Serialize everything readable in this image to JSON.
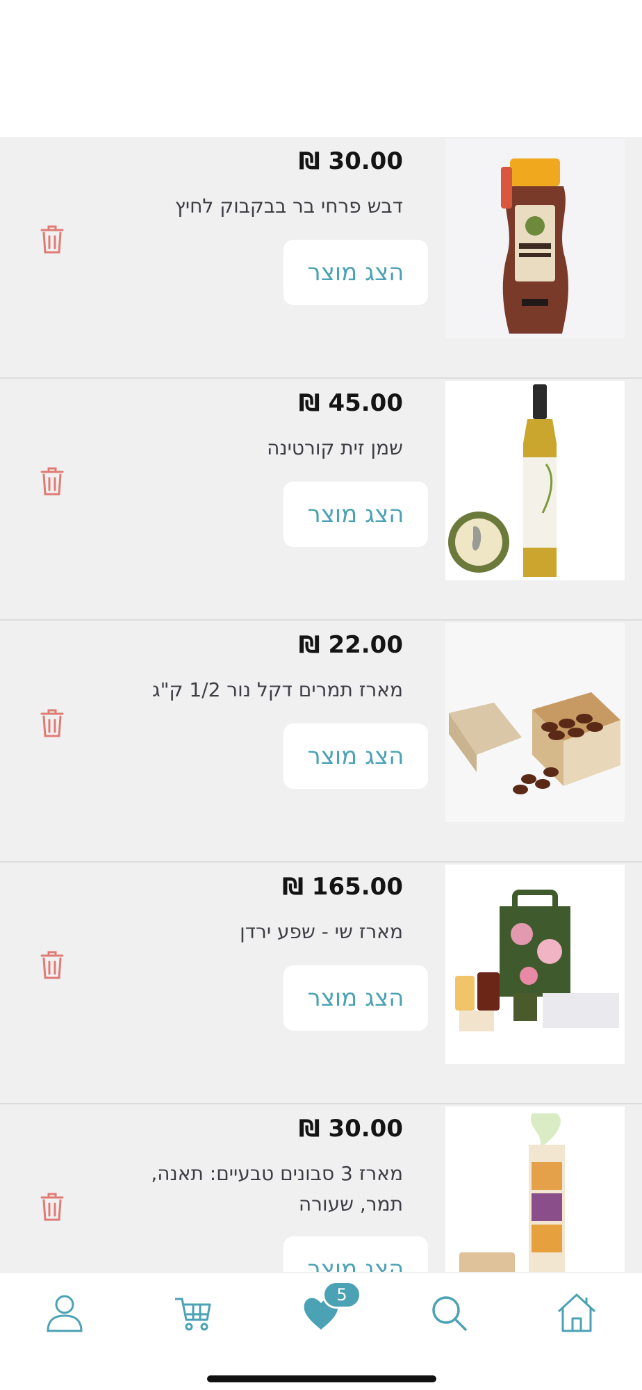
{
  "button_label": "הצג מוצר",
  "items": [
    {
      "price": "₪ 30.00",
      "name": "דבש פרחי בר בבקבוק לחיץ"
    },
    {
      "price": "₪ 45.00",
      "name": "שמן זית קורטינה"
    },
    {
      "price": "₪ 22.00",
      "name": "מארז תמרים דקל נור 1/2 ק\"ג"
    },
    {
      "price": "₪ 165.00",
      "name": "מארז שי - שפע ירדן"
    },
    {
      "price": "₪ 30.00",
      "name": "מארז 3 סבונים טבעיים: תאנה, תמר, שעורה"
    }
  ],
  "tabbar": {
    "items": [
      {
        "icon": "user-icon"
      },
      {
        "icon": "cart-icon"
      },
      {
        "icon": "heart-icon",
        "badge": "5"
      },
      {
        "icon": "search-icon"
      },
      {
        "icon": "home-icon"
      }
    ]
  },
  "colors": {
    "accent": "#4aa2b4",
    "trash": "#e07b74",
    "list_bg": "#f0f0f1"
  }
}
